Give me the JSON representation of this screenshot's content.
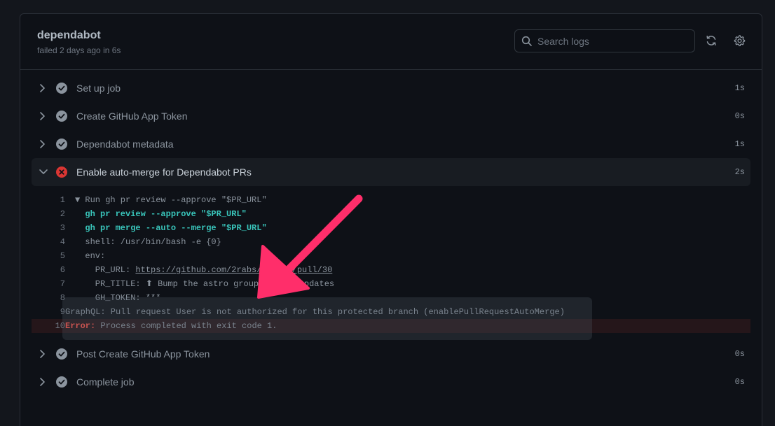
{
  "header": {
    "title": "dependabot",
    "subtitle": "failed 2 days ago in 6s",
    "search_placeholder": "Search logs"
  },
  "steps_before": [
    {
      "name": "Set up job",
      "duration": "1s",
      "status": "success"
    },
    {
      "name": "Create GitHub App Token",
      "duration": "0s",
      "status": "success"
    },
    {
      "name": "Dependabot metadata",
      "duration": "1s",
      "status": "success"
    }
  ],
  "active_step": {
    "name": "Enable auto-merge for Dependabot PRs",
    "duration": "2s",
    "status": "failure"
  },
  "log": [
    {
      "n": "1",
      "text": "▼ Run gh pr review --approve \"$PR_URL\""
    },
    {
      "n": "2",
      "text": "  gh pr review --approve \"$PR_URL\""
    },
    {
      "n": "3",
      "text": "  gh pr merge --auto --merge \"$PR_URL\""
    },
    {
      "n": "4",
      "text": "  shell: /usr/bin/bash -e {0}"
    },
    {
      "n": "5",
      "text": "  env:"
    },
    {
      "n": "6",
      "prefix": "    PR_URL: ",
      "link": "https://github.com/2rabs/nextjs/pull/30"
    },
    {
      "n": "7",
      "text": "    PR_TITLE: ⬆ Bump the astro group with 2 updates"
    },
    {
      "n": "8",
      "text": "    GH_TOKEN: ***"
    },
    {
      "n": "9",
      "text": "GraphQL: Pull request User is not authorized for this protected branch (enablePullRequestAutoMerge)"
    },
    {
      "n": "10",
      "error_label": "Error:",
      "text": " Process completed with exit code 1."
    }
  ],
  "steps_after": [
    {
      "name": "Post Create GitHub App Token",
      "duration": "0s",
      "status": "success"
    },
    {
      "name": "Complete job",
      "duration": "0s",
      "status": "success"
    }
  ],
  "colors": {
    "success_icon": "#8b949e",
    "failure_icon": "#da3633",
    "arrow": "#ff2e6a"
  }
}
